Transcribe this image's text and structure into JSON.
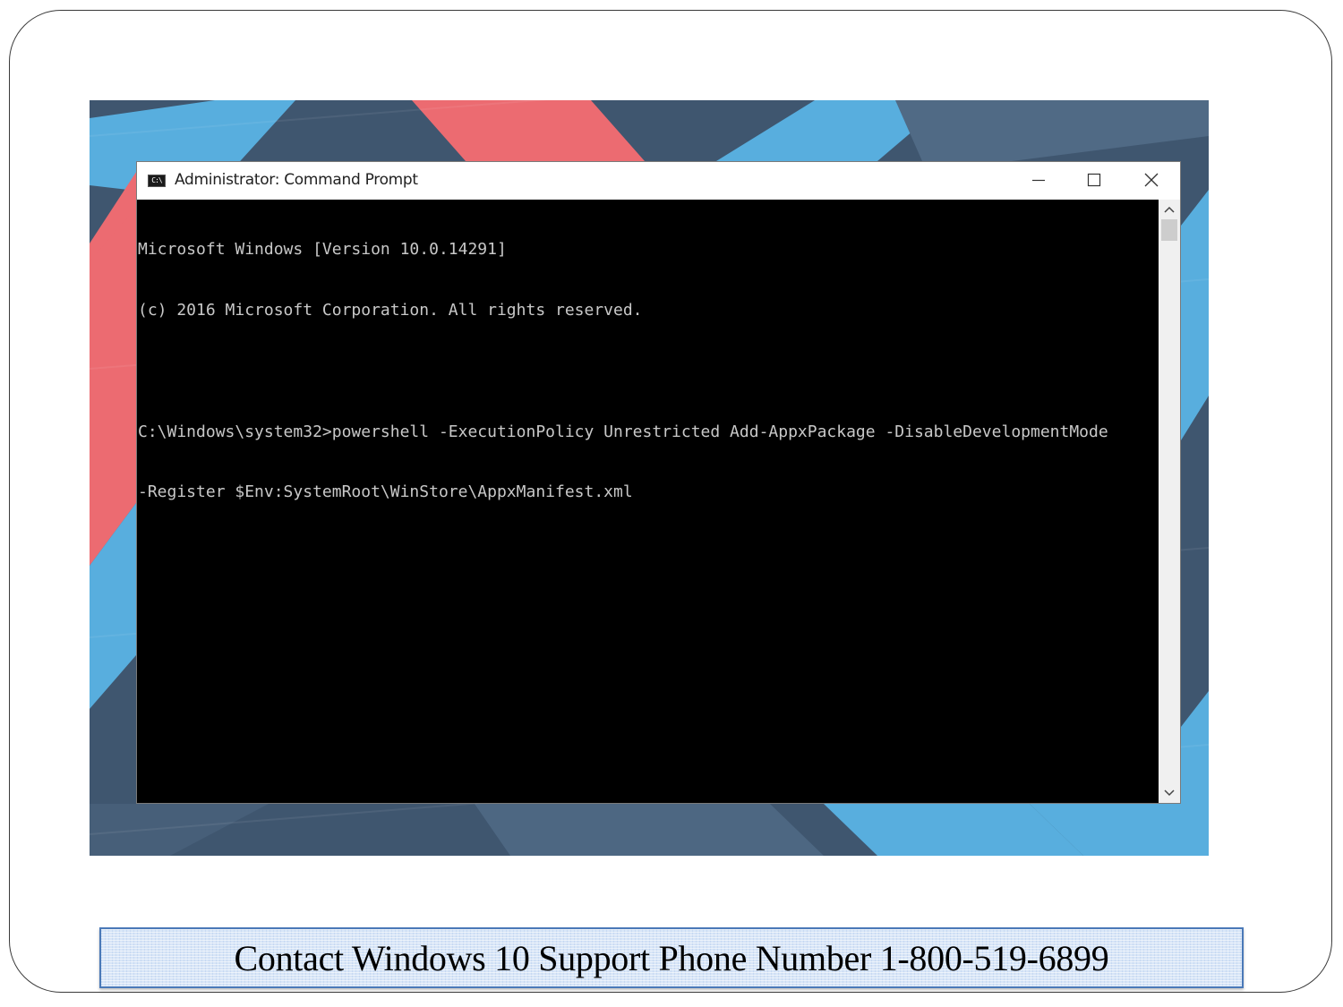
{
  "window": {
    "title": "Administrator: Command Prompt",
    "icon": "cmd-icon",
    "icon_text": "C:\\",
    "controls": [
      "minimize-icon",
      "maximize-icon",
      "close-icon"
    ]
  },
  "console": {
    "lines": [
      "Microsoft Windows [Version 10.0.14291]",
      "(c) 2016 Microsoft Corporation. All rights reserved.",
      "",
      "C:\\Windows\\system32>powershell -ExecutionPolicy Unrestricted Add-AppxPackage -DisableDevelopmentMode",
      "-Register $Env:SystemRoot\\WinStore\\AppxManifest.xml"
    ],
    "background": "#000000",
    "foreground": "#c8c8c8"
  },
  "wallpaper": {
    "colors": {
      "slate": "#3f566f",
      "coral": "#ec6b71",
      "sky": "#58aede"
    }
  },
  "caption": {
    "text": "Contact Windows 10 Support Phone Number 1-800-519-6899",
    "border_color": "#4a79b8",
    "fill_color": "#d7e5f7"
  }
}
